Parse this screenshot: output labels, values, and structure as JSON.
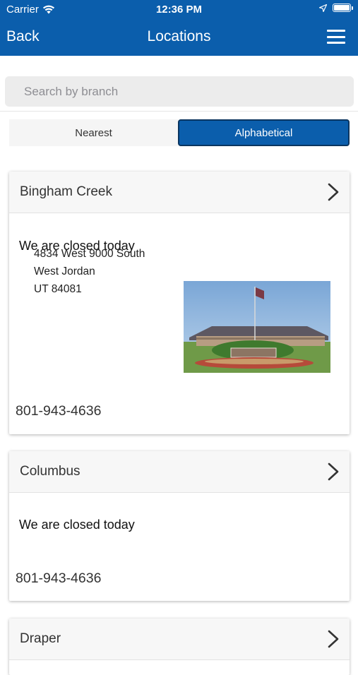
{
  "status_bar": {
    "carrier": "Carrier",
    "time": "12:36 PM",
    "wifi_icon": "wifi-icon",
    "location_icon": "location-arrow-icon",
    "battery_icon": "battery-icon"
  },
  "nav": {
    "back_label": "Back",
    "title": "Locations",
    "menu_icon": "hamburger-menu-icon"
  },
  "search": {
    "placeholder": "Search by branch",
    "value": ""
  },
  "sort": {
    "options": [
      "Nearest",
      "Alphabetical"
    ],
    "selected": "Alphabetical"
  },
  "colors": {
    "brand": "#0b5eac",
    "segment_border": "#0a3560"
  },
  "locations": [
    {
      "name": "Bingham Creek",
      "status": "We are closed today",
      "address": {
        "line1": "4834 West 9000 South",
        "line2": "West Jordan",
        "line3": "UT 84081"
      },
      "has_photo": true,
      "phone": "801-943-4636"
    },
    {
      "name": "Columbus",
      "status": "We are closed today",
      "phone": "801-943-4636"
    },
    {
      "name": "Draper"
    }
  ]
}
